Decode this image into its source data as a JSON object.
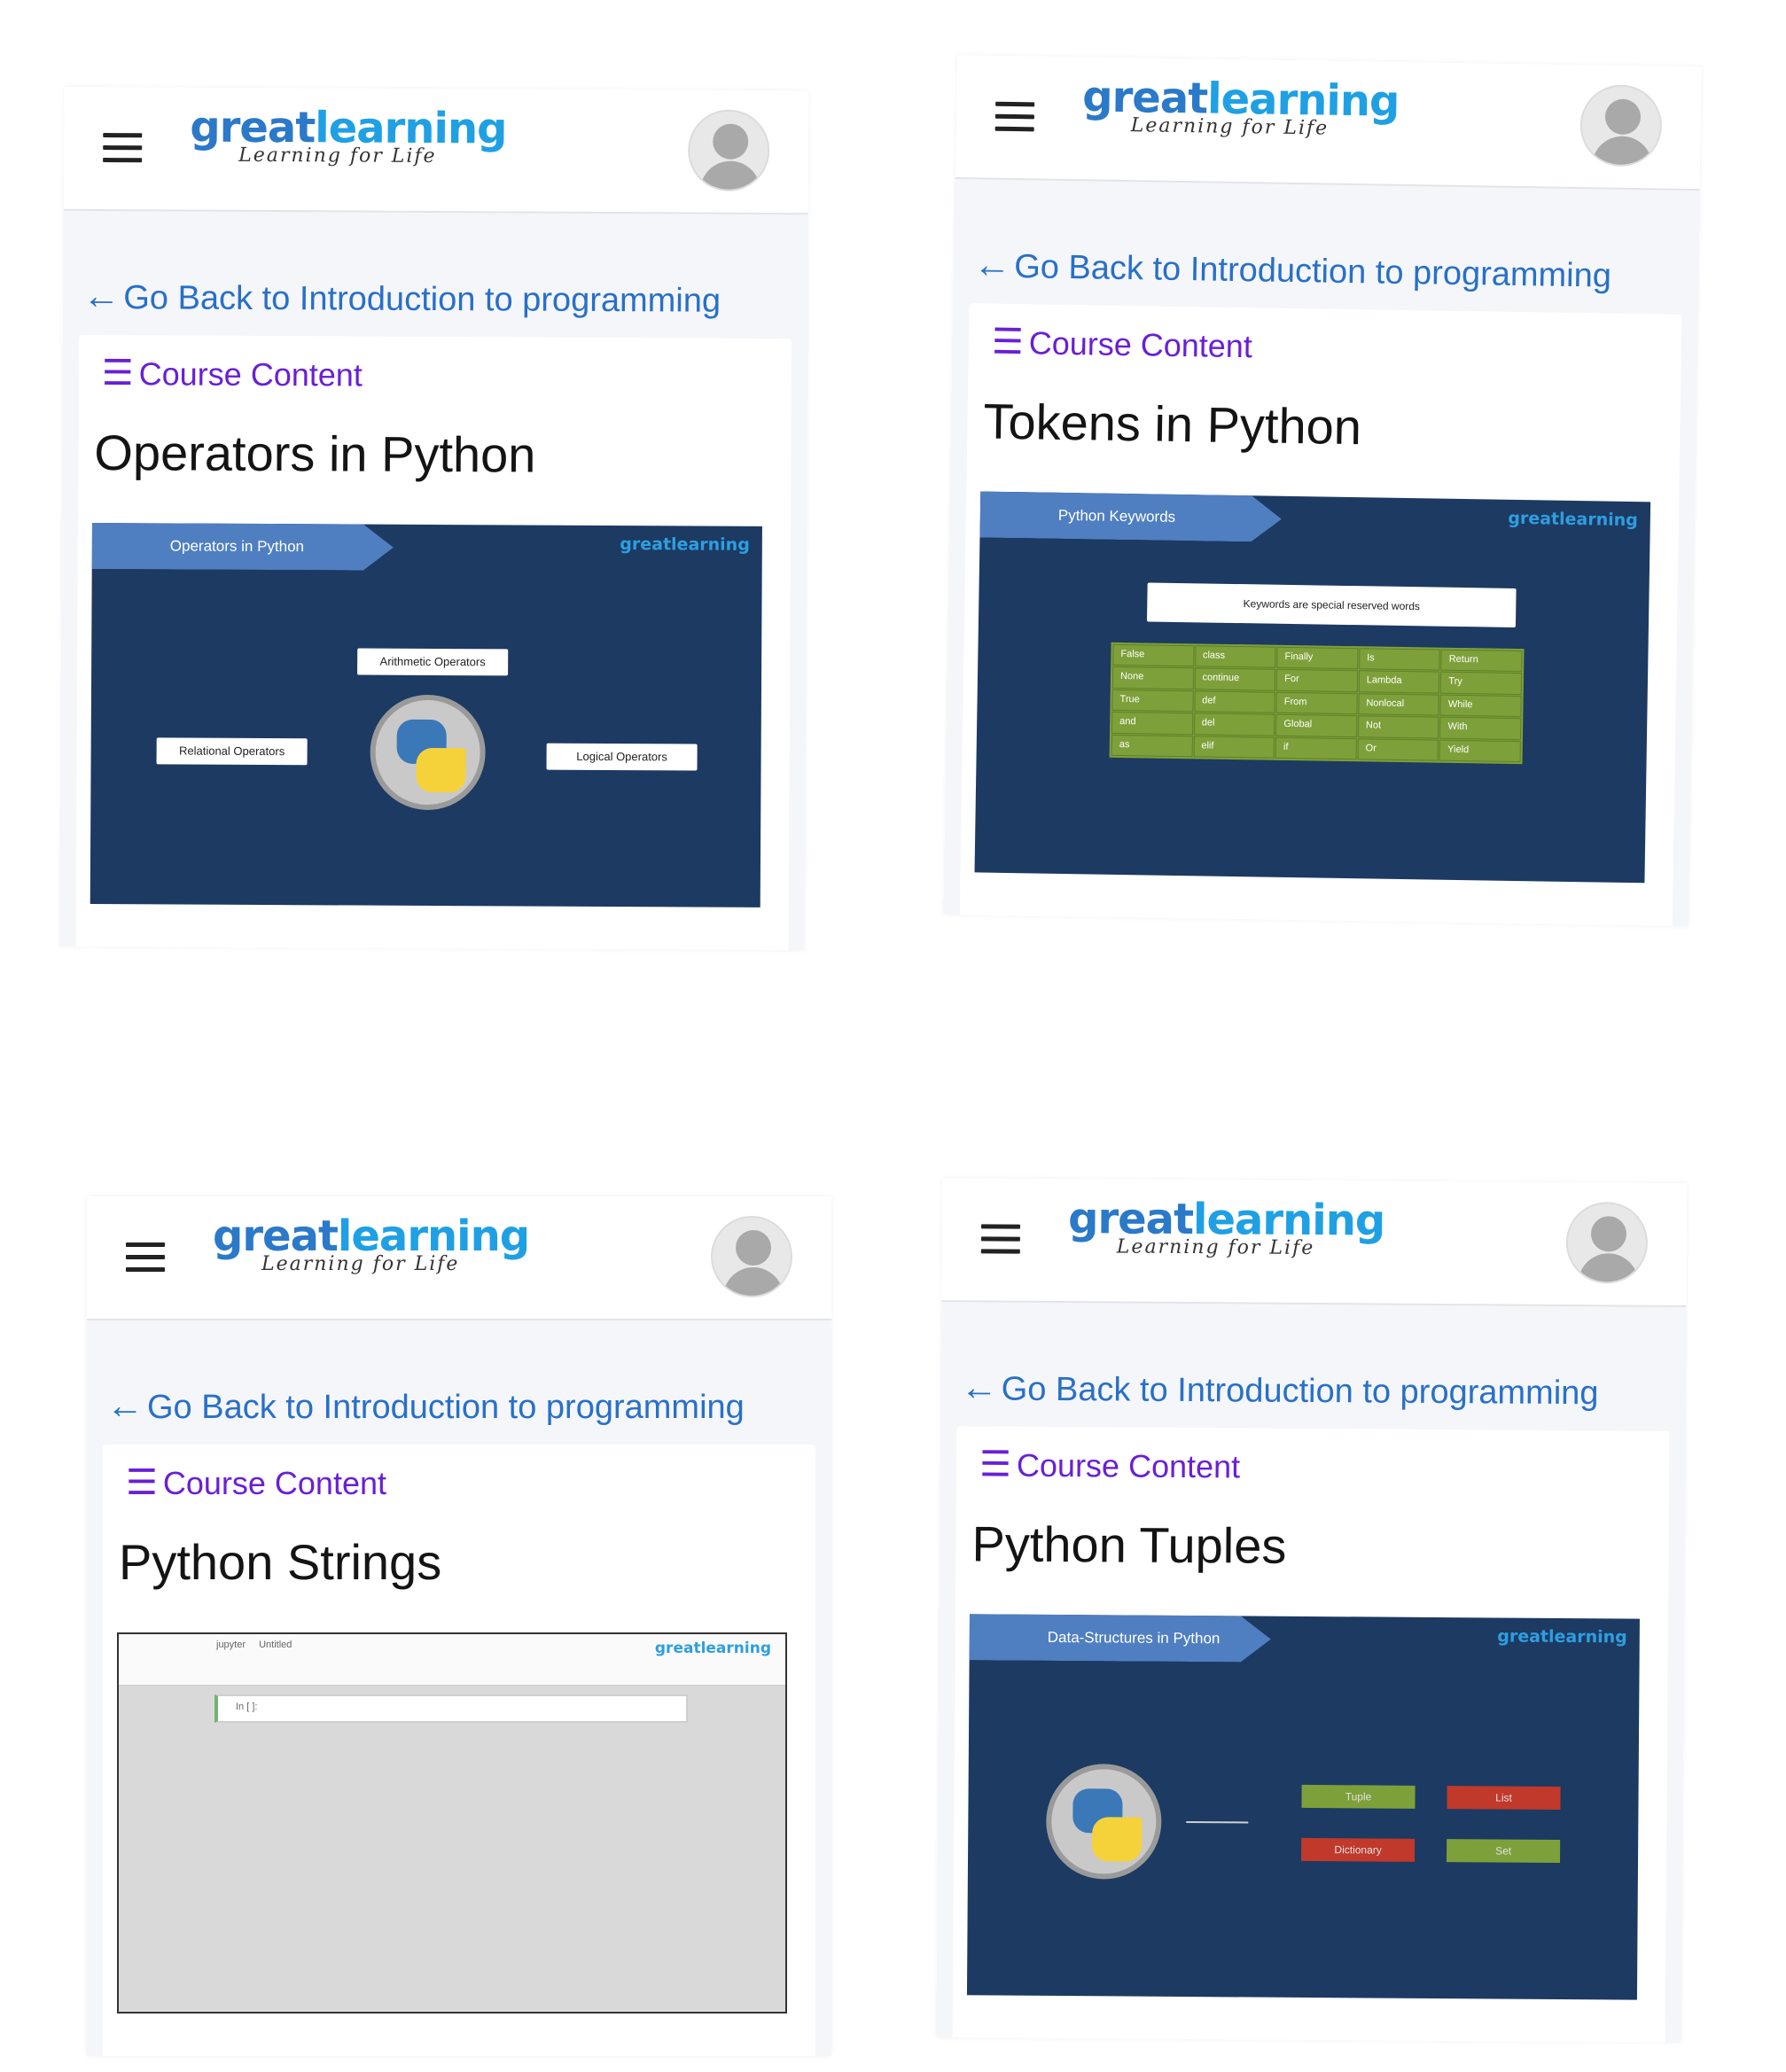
{
  "brand": {
    "name_bold": "great",
    "name_light": "learning",
    "tagline": "Learning for Life"
  },
  "nav": {
    "back_label": "Go Back to Introduction to programming",
    "course_content_label": "Course Content"
  },
  "screens": [
    {
      "lesson_title": "Operators in Python",
      "video": {
        "ribbon": "Operators in Python",
        "brand": "greatlearning",
        "labels": [
          "Arithmetic Operators",
          "Relational Operators",
          "Logical Operators"
        ]
      }
    },
    {
      "lesson_title": "Tokens in Python",
      "video": {
        "ribbon": "Python Keywords",
        "brand": "greatlearning",
        "banner": "Keywords are special reserved words",
        "keywords": [
          "False",
          "class",
          "Finally",
          "Is",
          "Return",
          "None",
          "continue",
          "For",
          "Lambda",
          "Try",
          "True",
          "def",
          "From",
          "Nonlocal",
          "While",
          "and",
          "del",
          "Global",
          "Not",
          "With",
          "as",
          "elif",
          "if",
          "Or",
          "Yield"
        ]
      }
    },
    {
      "lesson_title": "Python Strings",
      "video": {
        "app_name": "jupyter",
        "notebook_name": "Untitled",
        "brand": "greatlearning",
        "cell_prompt": "In [ ]:"
      }
    },
    {
      "lesson_title": "Python Tuples",
      "video": {
        "ribbon": "Data-Structures in Python",
        "brand": "greatlearning",
        "tags": [
          "Tuple",
          "List",
          "Dictionary",
          "Set"
        ]
      }
    }
  ],
  "colors": {
    "link_blue": "#2870c8",
    "course_purple": "#6a1fd6",
    "video_bg": "#1c3a62",
    "ribbon": "#4f7fc0",
    "tag_green": "#7ea03a",
    "tag_red": "#c0392b"
  },
  "icons": {
    "menu": "hamburger-icon",
    "avatar": "user-avatar-icon",
    "back": "arrow-left-icon",
    "course": "list-icon"
  }
}
